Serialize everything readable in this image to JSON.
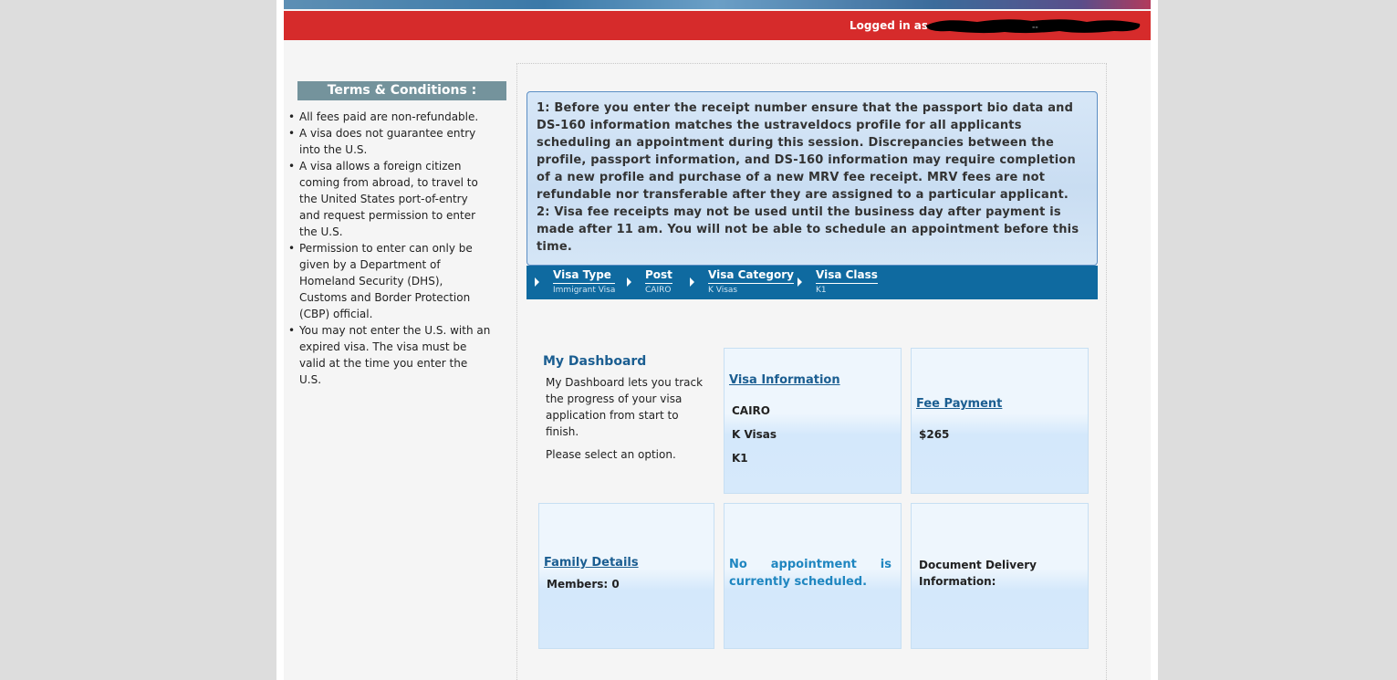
{
  "header": {
    "logged_in_label": "Logged in as",
    "user_suffix": "--"
  },
  "terms": {
    "title": "Terms & Conditions :",
    "items": [
      "All fees paid are non-refundable.",
      "A visa does not guarantee entry into the U.S.",
      "A visa allows a foreign citizen coming from abroad, to travel to the United States port-of-entry and request permission to enter the U.S.",
      "Permission to enter can only be given by a Department of Homeland Security (DHS), Customs and Border Protection (CBP) official.",
      "You may not enter the U.S. with an expired visa. The visa must be valid at the time you enter the U.S."
    ]
  },
  "notice": {
    "line1": "1: Before you enter the receipt number ensure that the passport bio data and DS-160 information matches the ustraveldocs profile for all applicants scheduling an appointment during this session. Discrepancies between the profile, passport information, and DS-160 information may require completion of a new profile and purchase of a new MRV fee receipt. MRV fees are not refundable nor transferable after they are assigned to a particular applicant.",
    "line2": "2: Visa fee receipts may not be used until the business day after payment is made after 11 am. You will not be able to schedule an appointment before this time."
  },
  "breadcrumbs": [
    {
      "title": "Visa Type",
      "value": "Immigrant Visa"
    },
    {
      "title": "Post",
      "value": "CAIRO"
    },
    {
      "title": "Visa Category",
      "value": "K Visas"
    },
    {
      "title": "Visa Class",
      "value": "K1"
    }
  ],
  "dashboard": {
    "title": "My Dashboard",
    "description": "My Dashboard lets you track the progress of your visa application from start to finish.",
    "prompt": "Please select an option."
  },
  "cards": {
    "visa_info": {
      "title": "Visa Information",
      "post": "CAIRO",
      "category": "K Visas",
      "class": "K1"
    },
    "fee_payment": {
      "title": "Fee Payment",
      "amount": "$265"
    },
    "family": {
      "title": "Family Details",
      "members": "Members: 0"
    },
    "appointment": {
      "status": "No appointment is currently scheduled."
    },
    "delivery": {
      "label": "Document Delivery Information:"
    }
  },
  "colors": {
    "login_bar": "#d62b2b",
    "breadcrumb_bar": "#0f6aa0",
    "terms_header": "#74939c",
    "link": "#1b5e91",
    "appointment_text": "#1f86c0"
  }
}
